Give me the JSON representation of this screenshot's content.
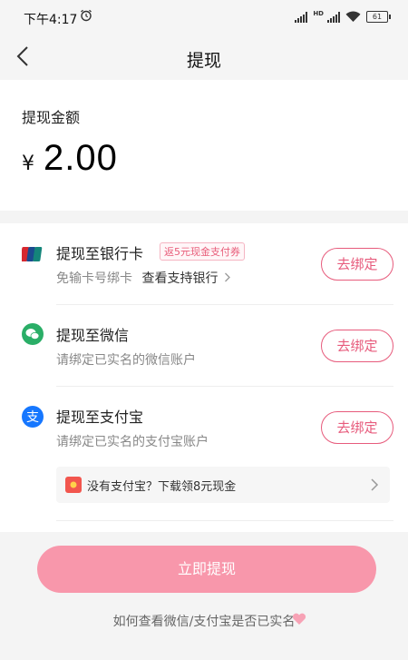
{
  "status_bar": {
    "time": "下午4:17",
    "network_badge": "HD",
    "battery": "61"
  },
  "nav": {
    "title": "提现",
    "back_icon": "chevron-left-icon"
  },
  "amount": {
    "label": "提现金额",
    "currency": "¥",
    "value": "2.00"
  },
  "methods": [
    {
      "title": "提现至银行卡",
      "tag": "返5元现金支付券",
      "subtitle": "免输卡号绑卡",
      "link": "查看支持银行",
      "button": "去绑定",
      "icon": "unionpay-icon"
    },
    {
      "title": "提现至微信",
      "subtitle": "请绑定已实名的微信账户",
      "button": "去绑定",
      "icon": "wechat-icon"
    },
    {
      "title": "提现至支付宝",
      "subtitle": "请绑定已实名的支付宝账户",
      "button": "去绑定",
      "icon": "alipay-icon"
    }
  ],
  "alipay_tip": {
    "text": "没有支付宝？下载领8元现金",
    "icon": "red-packet-icon"
  },
  "submit_button": "立即提现",
  "help_link": "如何查看微信/支付宝是否已实名",
  "colors": {
    "accent": "#e75b7c",
    "button_fill": "#f897ab",
    "unionpay_red": "#d7282f",
    "wechat_green": "#2aae67",
    "alipay_blue": "#1677ff"
  }
}
